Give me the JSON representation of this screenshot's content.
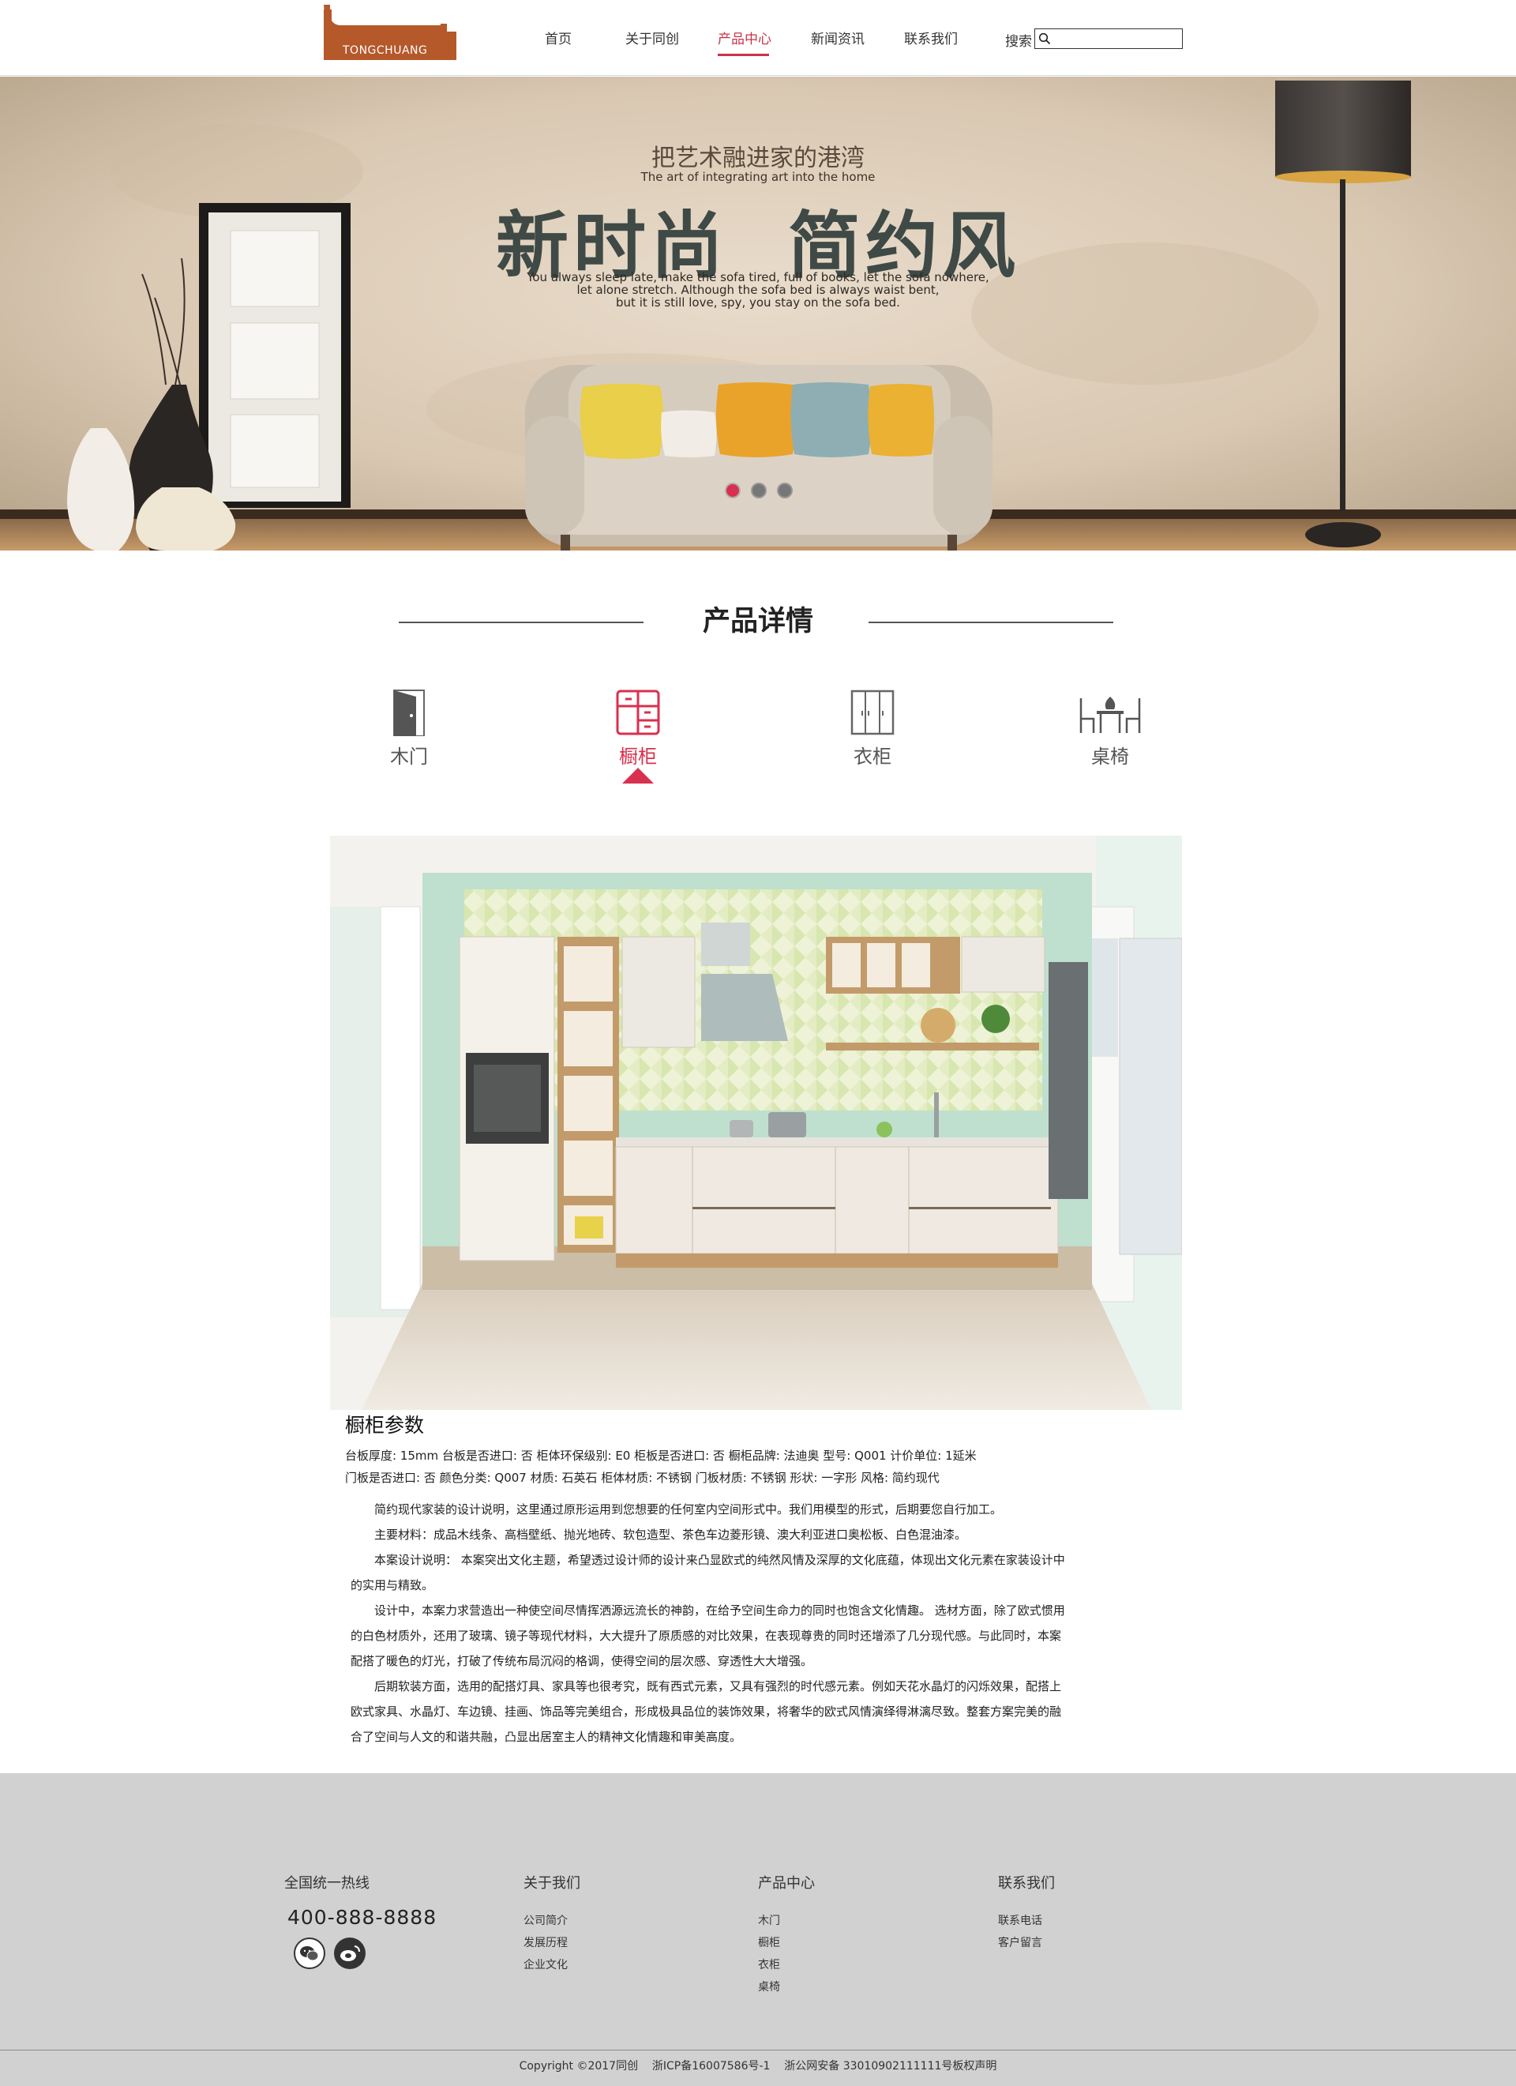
{
  "header": {
    "logo_text": "TONGCHUANG",
    "nav": [
      {
        "label": "首页"
      },
      {
        "label": "关于同创"
      },
      {
        "label": "产品中心"
      },
      {
        "label": "新闻资讯"
      },
      {
        "label": "联系我们"
      }
    ],
    "active_nav": "产品中心",
    "search_label": "搜索",
    "search_value": ""
  },
  "banner": {
    "subtitle_cn": "把艺术融进家的港湾",
    "subtitle_en": "The art of integrating art into the home",
    "title": "新时尚  简约风",
    "desc_line1": "You always sleep late, make the sofa tired, full of books, let the sofa nowhere,",
    "desc_line2": "let alone stretch. Although the sofa bed is always waist bent,",
    "desc_line3": "but it is still love, spy, you stay on the sofa bed.",
    "slide_count": 3,
    "active_slide": 1
  },
  "section": {
    "title": "产品详情"
  },
  "categories": [
    {
      "label": "木门",
      "icon": "door-icon"
    },
    {
      "label": "橱柜",
      "icon": "cabinet-icon"
    },
    {
      "label": "衣柜",
      "icon": "wardrobe-icon"
    },
    {
      "label": "桌椅",
      "icon": "table-chairs-icon"
    }
  ],
  "active_category": "橱柜",
  "params": {
    "title": "橱柜参数",
    "line1": "台板厚度: 15mm    台板是否进口: 否    柜体环保级别: E0    柜板是否进口: 否    橱柜品牌: 法迪奥    型号: Q001    计价单位: 1延米",
    "line2": "门板是否进口: 否    颜色分类: Q007   材质: 石英石    柜体材质: 不锈钢    门板材质: 不锈钢    形状: 一字形    风格: 简约现代"
  },
  "description": {
    "p1": "简约现代家装的设计说明，这里通过原形运用到您想要的任何室内空间形式中。我们用模型的形式，后期要您自行加工。",
    "p2": "主要材料：成品木线条、高档壁纸、抛光地砖、软包造型、茶色车边菱形镜、澳大利亚进口奥松板、白色混油漆。",
    "p3": "本案设计说明：       本案突出文化主题，希望透过设计师的设计来凸显欧式的纯然风情及深厚的文化底蕴，体现出文化元素在家装设计中的实用与精致。",
    "p4": "设计中，本案力求营造出一种使空间尽情挥洒源远流长的神韵，在给予空间生命力的同时也饱含文化情趣。   选材方面，除了欧式惯用的白色材质外，还用了玻璃、镜子等现代材料，大大提升了原质感的对比效果，在表现尊贵的同时还增添了几分现代感。与此同时，本案配搭了暖色的灯光，打破了传统布局沉闷的格调，使得空间的层次感、穿透性大大增强。",
    "p5": "后期软装方面，选用的配搭灯具、家具等也很考究，既有西式元素，又具有强烈的时代感元素。例如天花水晶灯的闪烁效果，配搭上欧式家具、水晶灯、车边镜、挂画、饰品等完美组合，形成极具品位的装饰效果，将奢华的欧式风情演绎得淋漓尽致。整套方案完美的融合了空间与人文的和谐共融，凸显出居室主人的精神文化情趣和审美高度。"
  },
  "footer": {
    "hotline_label": "全国统一热线",
    "hotline": "400-888-8888",
    "about": {
      "heading": "关于我们",
      "links": [
        "公司简介",
        "发展历程",
        "企业文化"
      ]
    },
    "products": {
      "heading": "产品中心",
      "links": [
        "木门",
        "橱柜",
        "衣柜",
        "桌椅"
      ]
    },
    "contact": {
      "heading": "联系我们",
      "links": [
        "联系电话",
        "客户留言"
      ]
    },
    "social": [
      "wechat-icon",
      "weibo-icon"
    ],
    "copyright": "Copyright ©2017同创    浙ICP备16007586号-1    浙公网安备 33010902111111号板权声明"
  },
  "colors": {
    "accent": "#d9304f",
    "logo": "#b5582a",
    "footer_bg": "#d1d1d1"
  }
}
